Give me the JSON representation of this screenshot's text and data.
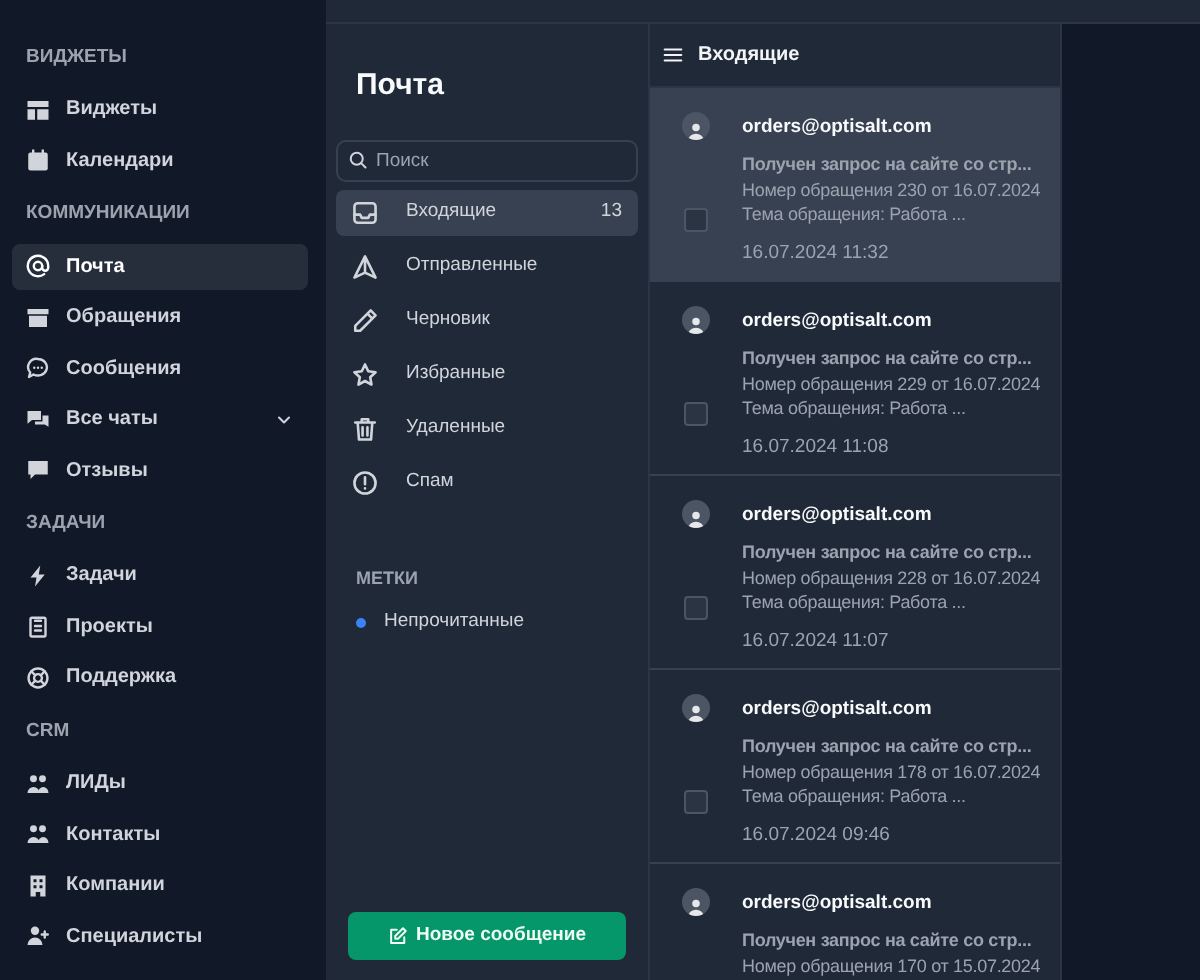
{
  "sidebar": {
    "sections": [
      {
        "title": "ВИДЖЕТЫ",
        "items": [
          {
            "label": "Виджеты",
            "kind": "link",
            "selected": false
          },
          {
            "label": "Календари",
            "kind": "link",
            "selected": false
          }
        ]
      },
      {
        "title": "КОММУНИКАЦИИ",
        "items": [
          {
            "label": "Почта",
            "kind": "link",
            "selected": true
          },
          {
            "label": "Обращения",
            "kind": "link",
            "selected": false
          },
          {
            "label": "Сообщения",
            "kind": "link",
            "selected": false
          },
          {
            "label": "Все чаты",
            "kind": "group",
            "selected": false
          },
          {
            "label": "Отзывы",
            "kind": "link",
            "selected": false
          }
        ]
      },
      {
        "title": "ЗАДАЧИ",
        "items": [
          {
            "label": "Задачи",
            "kind": "link",
            "selected": false
          },
          {
            "label": "Проекты",
            "kind": "link",
            "selected": false
          },
          {
            "label": "Поддержка",
            "kind": "link",
            "selected": false
          }
        ]
      },
      {
        "title": "CRM",
        "items": [
          {
            "label": "ЛИДы",
            "kind": "link",
            "selected": false
          },
          {
            "label": "Контакты",
            "kind": "link",
            "selected": false
          },
          {
            "label": "Компании",
            "kind": "link",
            "selected": false
          },
          {
            "label": "Специалисты",
            "kind": "link",
            "selected": false
          }
        ]
      }
    ]
  },
  "mail": {
    "title": "Почта",
    "search": {
      "placeholder": "Поиск"
    },
    "folders": [
      {
        "label": "Входящие",
        "count": "13",
        "selected": true
      },
      {
        "label": "Отправленные",
        "selected": false
      },
      {
        "label": "Черновик",
        "selected": false
      },
      {
        "label": "Избранные",
        "selected": false
      },
      {
        "label": "Удаленные",
        "selected": false
      },
      {
        "label": "Спам",
        "selected": false
      }
    ],
    "labels_title": "МЕТКИ",
    "labels": [
      {
        "label": "Непрочитанные",
        "color": "#3b82f6"
      }
    ],
    "new_button": "Новое сообщение"
  },
  "inbox": {
    "title": "Входящие",
    "messages": [
      {
        "sender": "orders@optisalt.com",
        "lines": [
          "Получен запрос на сайте со стр...",
          "Номер обращения 230 от 16.07.2024",
          "Тема обращения: Работа ..."
        ],
        "time": "16.07.2024 11:32",
        "selected": true,
        "checked": false
      },
      {
        "sender": "orders@optisalt.com",
        "lines": [
          "Получен запрос на сайте со стр...",
          "Номер обращения 229 от 16.07.2024",
          "Тема обращения: Работа ..."
        ],
        "time": "16.07.2024 11:08",
        "selected": false,
        "checked": false
      },
      {
        "sender": "orders@optisalt.com",
        "lines": [
          "Получен запрос на сайте со стр...",
          "Номер обращения 228 от 16.07.2024",
          "Тема обращения: Работа ..."
        ],
        "time": "16.07.2024 11:07",
        "selected": false,
        "checked": false
      },
      {
        "sender": "orders@optisalt.com",
        "lines": [
          "Получен запрос на сайте со стр...",
          "Номер обращения 178 от 16.07.2024",
          "Тема обращения: Работа ..."
        ],
        "time": "16.07.2024 09:46",
        "selected": false,
        "checked": false
      },
      {
        "sender": "orders@optisalt.com",
        "lines": [
          "Получен запрос на сайте со стр...",
          "Номер обращения 170 от 15.07.2024"
        ],
        "selected": false
      }
    ]
  }
}
